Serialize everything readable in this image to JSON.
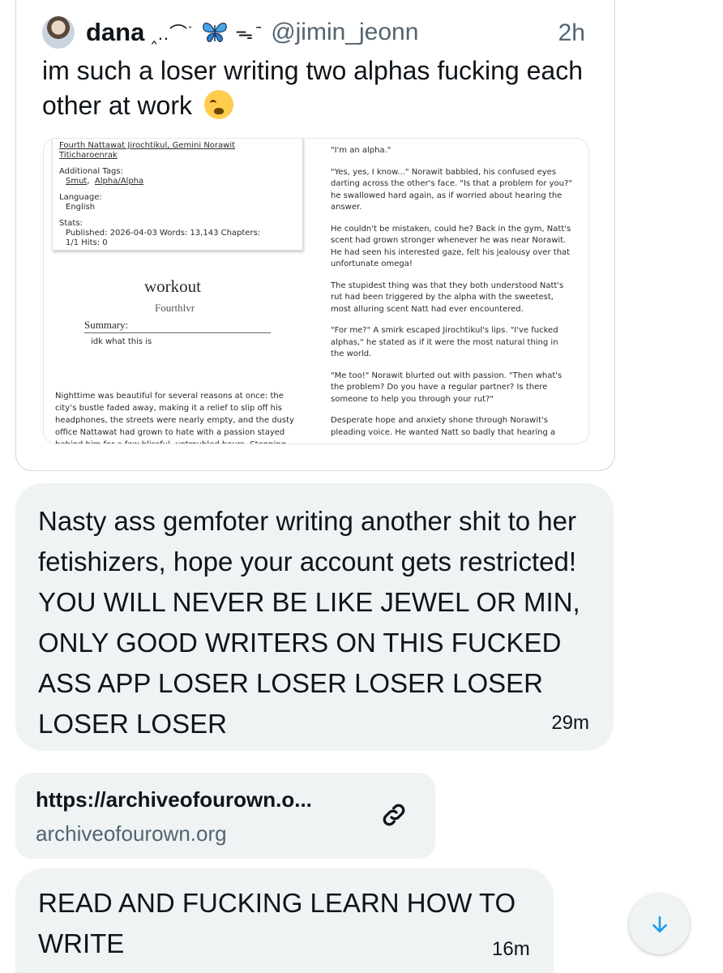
{
  "quoted_tweet": {
    "author_name": "dana",
    "name_decoration": "‸..⌒˙",
    "name_decoration_2": "ᯓ ̄",
    "handle": "@jimin_jeonn",
    "time": "2h",
    "text": "im such a loser writing two alphas fucking each other at work",
    "emoji": "loudly-crying-face",
    "screenshot": {
      "relationships_line1": "Fourth Nattawat Jirochtikul,  Gemini Norawit",
      "relationships_line2": "Titicharoenrak",
      "additional_tags_label": "Additional Tags:",
      "tag_1": "Smut",
      "tag_2": "Alpha/Alpha",
      "language_label": "Language:",
      "language": "English",
      "stats_label": "Stats:",
      "stats_line1": "Published:  2026-04-03   Words:  13,143   Chapters:",
      "stats_line2": "1/1   Hits:  0",
      "work_title": "workout",
      "work_author": "Fourthlvr",
      "summary_label": "Summary:",
      "summary_text": "idk what this is",
      "left_body": "Nighttime was beautiful for several reasons at once: the city’s bustle faded away, making it a relief to slip off his headphones, the streets were nearly empty, and the dusty office Nattawat had grown to hate with a passion stayed behind him for a few blissful, untroubled hours. Stepping",
      "right_paragraphs": [
        "\"I'm an alpha.\"",
        "\"Yes, yes, I know...\" Norawit babbled, his confused eyes darting across the other's face. \"Is that a problem for you?\" he swallowed hard again, as if worried about hearing the answer.",
        "He couldn't be mistaken, could he? Back in the gym, Natt's scent had grown stronger whenever he was near Norawit. He had seen his interested gaze, felt his jealousy over that unfortunate omega!",
        "The stupidest thing was that they both understood Natt's rut had been triggered by the alpha with the sweetest, most alluring scent Natt had ever encountered.",
        "\"For me?\" A smirk escaped Jirochtikul's lips. \"I've fucked alphas,\" he stated as if it were the most natural thing in the world.",
        "\"Me too!\" Norawit blurted out with passion. \"Then what's the problem? Do you have a regular partner? Is there someone to help you through your rut?\"",
        "Desperate hope and anxiety shone through Norawit's pleading voice. He wanted Natt so badly that hearing a"
      ]
    }
  },
  "messages": [
    {
      "text": "Nasty ass gemfoter writing another shit to her fetishizers, hope your account gets restricted! YOU WILL NEVER BE LIKE JEWEL OR MIN, ONLY GOOD WRITERS ON THIS FUCKED ASS APP LOSER LOSER LOSER LOSER LOSER LOSER",
      "time": "29m"
    },
    {
      "text": "READ AND FUCKING LEARN HOW TO WRITE",
      "time": "16m"
    }
  ],
  "link_card": {
    "title": "https://archiveofourown.o...",
    "domain": "archiveofourown.org",
    "icon": "link-icon"
  },
  "scroll_button": {
    "icon": "arrow-down-icon"
  },
  "colors": {
    "bubble_bg": "#eff3f4",
    "secondary_text": "#536471",
    "accent": "#1d9bf0"
  }
}
